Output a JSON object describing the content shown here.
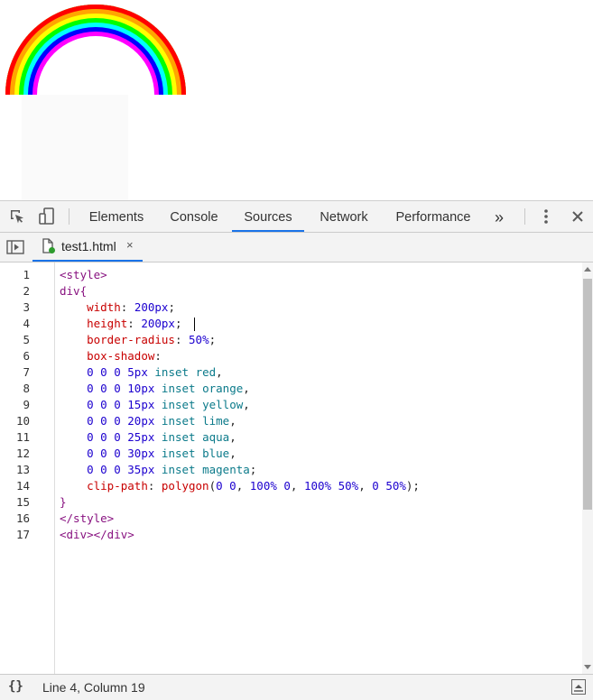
{
  "toolbar": {
    "tabs": [
      "Elements",
      "Console",
      "Sources",
      "Network",
      "Performance"
    ],
    "active_tab": "Sources",
    "overflow_label": "»"
  },
  "file_tab": {
    "name": "test1.html",
    "close": "×"
  },
  "editor": {
    "line_numbers": [
      "1",
      "2",
      "3",
      "4",
      "5",
      "6",
      "7",
      "8",
      "9",
      "10",
      "11",
      "12",
      "13",
      "14",
      "15",
      "16",
      "17"
    ],
    "code": {
      "l1_tag": "<style>",
      "l2_sel": "div{",
      "l3_prop": "width",
      "l3_val": "200px",
      "l4_prop": "height",
      "l4_val": "200px",
      "l5_prop": "border-radius",
      "l5_val": "50%",
      "l6_prop": "box-shadow",
      "shadows": [
        {
          "offsets": "0 0 0",
          "size": "5px",
          "kw": "inset",
          "color": "red"
        },
        {
          "offsets": "0 0 0",
          "size": "10px",
          "kw": "inset",
          "color": "orange"
        },
        {
          "offsets": "0 0 0",
          "size": "15px",
          "kw": "inset",
          "color": "yellow"
        },
        {
          "offsets": "0 0 0",
          "size": "20px",
          "kw": "inset",
          "color": "lime"
        },
        {
          "offsets": "0 0 0",
          "size": "25px",
          "kw": "inset",
          "color": "aqua"
        },
        {
          "offsets": "0 0 0",
          "size": "30px",
          "kw": "inset",
          "color": "blue"
        },
        {
          "offsets": "0 0 0",
          "size": "35px",
          "kw": "inset",
          "color": "magenta"
        }
      ],
      "l14_prop": "clip-path",
      "l14_fn": "polygon",
      "l14_args": [
        "0 0",
        "100% 0",
        "100% 50%",
        "0 50%"
      ],
      "l15_close": "}",
      "l16_tag": "</style>",
      "l17_tag": "<div></div>"
    }
  },
  "status": {
    "pretty_print": "{}",
    "position": "Line 4, Column 19"
  },
  "colors": {
    "accent": "#1a73e8",
    "tag": "#881280",
    "property": "#c80000",
    "number": "#1c00cf",
    "keyword": "#0b7a8a"
  }
}
